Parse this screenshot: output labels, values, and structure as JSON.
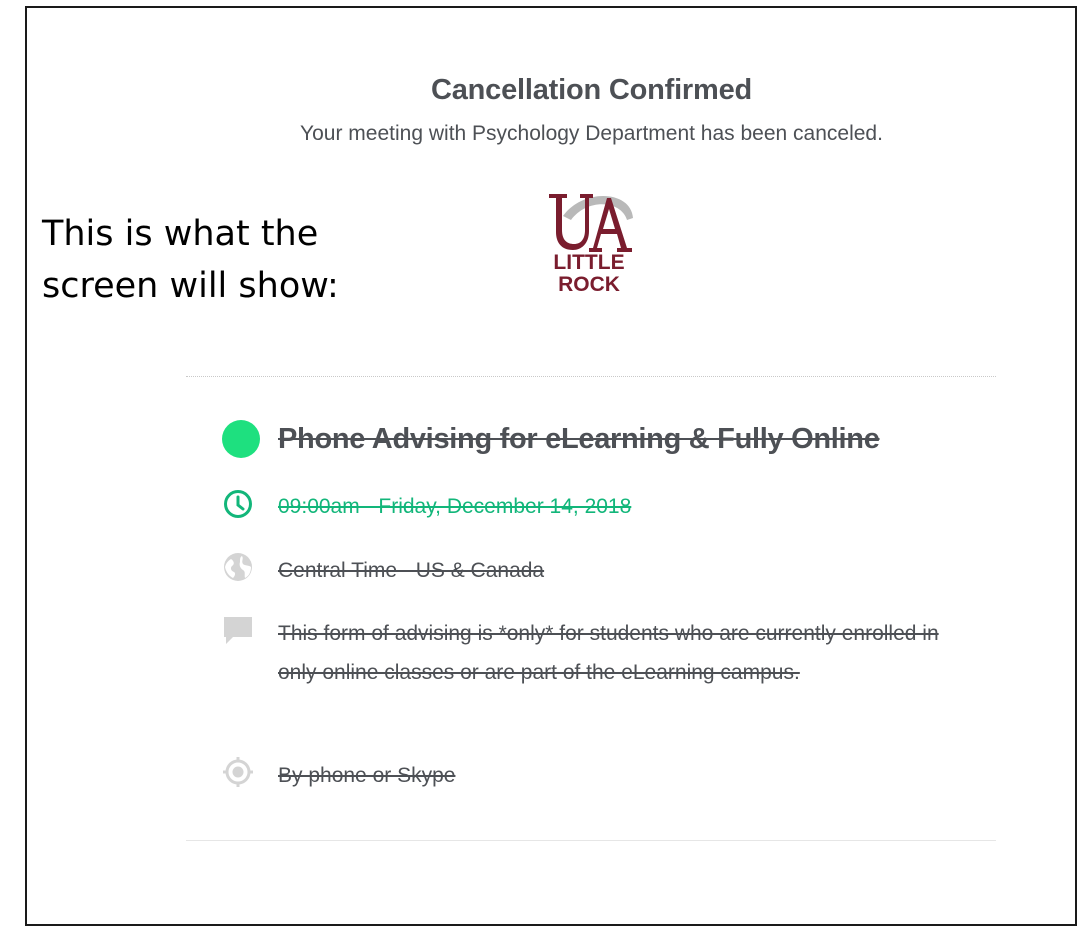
{
  "header": {
    "title": "Cancellation Confirmed",
    "subtitle": "Your meeting with Psychology Department has been canceled."
  },
  "logo": {
    "name": "UA Little Rock logo",
    "letters_top": "UA",
    "letters_mid": "LITTLE",
    "letters_bottom": "ROCK"
  },
  "annotation": {
    "text": "This is what the screen will show:"
  },
  "event": {
    "title": "Phone Advising for eLearning & Fully Online",
    "color": "#1ee07f",
    "time": "09:00am - Friday, December 14, 2018",
    "timezone": "Central Time - US & Canada",
    "description": "This form of advising is *only* for students who are currently enrolled in only online classes or are part of the eLearning campus.",
    "location": "By phone or Skype"
  },
  "icons": {
    "time": "clock-icon",
    "timezone": "globe-icon",
    "description": "speech-bubble-icon",
    "location": "location-target-icon"
  },
  "colors": {
    "accent": "#12b67a",
    "text": "#4d5055",
    "brand": "#7a1d2e"
  }
}
